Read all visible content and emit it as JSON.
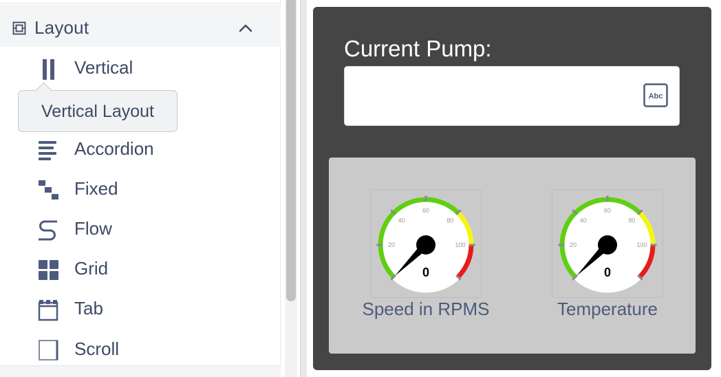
{
  "palette": {
    "section_title": "Layout",
    "items": [
      {
        "label": "Vertical",
        "icon": "vertical-layout-icon"
      },
      {
        "label": "Accordion",
        "icon": "accordion-icon"
      },
      {
        "label": "Fixed",
        "icon": "fixed-layout-icon"
      },
      {
        "label": "Flow",
        "icon": "flow-layout-icon"
      },
      {
        "label": "Grid",
        "icon": "grid-layout-icon"
      },
      {
        "label": "Tab",
        "icon": "tab-layout-icon"
      },
      {
        "label": "Scroll",
        "icon": "scroll-layout-icon"
      }
    ],
    "tooltip": "Vertical Layout"
  },
  "canvas": {
    "pump_label": "Current Pump:",
    "pump_value": "",
    "abc_icon_text": "Abc",
    "gauges": [
      {
        "title": "Speed in RPMS",
        "value": "0",
        "ticks": [
          "20",
          "40",
          "60",
          "80",
          "100"
        ]
      },
      {
        "title": "Temperature",
        "value": "0",
        "ticks": [
          "20",
          "40",
          "60",
          "80",
          "100"
        ]
      }
    ]
  },
  "colors": {
    "panel": "#454545",
    "gauge_panel": "#cacaca",
    "gauge_green": "#5fcf13",
    "gauge_yellow": "#f5f514",
    "gauge_red": "#e61c1c",
    "text": "#3d4966"
  }
}
